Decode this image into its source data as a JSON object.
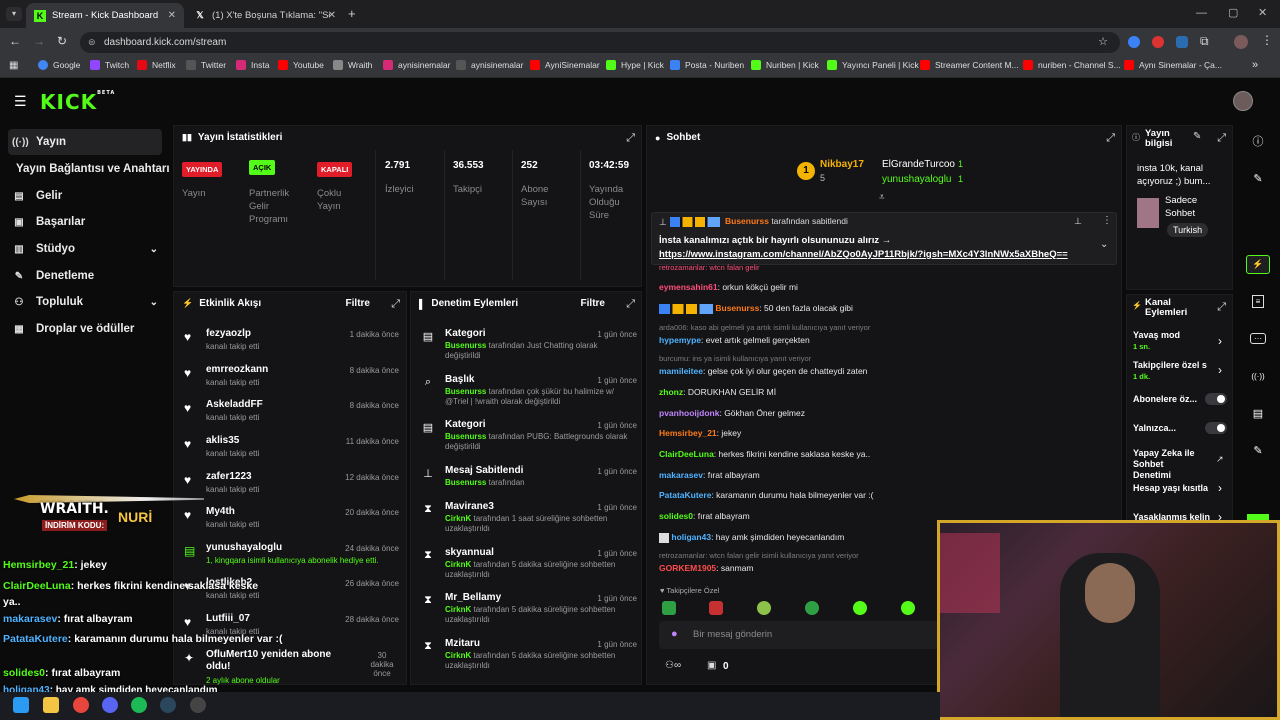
{
  "browser": {
    "tabs": [
      {
        "label": "Stream - Kick Dashboard",
        "active": true
      },
      {
        "label": "(1) X'te Boşuna Tıklama: \"Soru:",
        "active": false
      }
    ],
    "url": "dashboard.kick.com/stream",
    "bookmarks": [
      "Google",
      "Twitch",
      "Netflix",
      "Twitter",
      "Insta",
      "Youtube",
      "Wraith",
      "aynisinemalar",
      "aynisinemalar",
      "AyniSinemalar",
      "Hype | Kick",
      "Posta - Nuriben",
      "Nuriben | Kick",
      "Yayıncı Paneli | Kick",
      "Streamer Content M...",
      "nuriben - Channel S...",
      "Aynı Sinemalar - Ça..."
    ]
  },
  "kick": {
    "logo": "KICK",
    "beta": "BETA"
  },
  "sidebar": {
    "items": [
      {
        "label": "Yayın",
        "icon": "broadcast-icon"
      },
      {
        "label": "Yayın Bağlantısı ve Anahtarı",
        "icon": ""
      },
      {
        "label": "Gelir",
        "icon": "revenue-icon"
      },
      {
        "label": "Başarılar",
        "icon": "trophy-icon"
      },
      {
        "label": "Stüdyo",
        "icon": "studio-icon"
      },
      {
        "label": "Denetleme",
        "icon": "wrench-icon"
      },
      {
        "label": "Topluluk",
        "icon": "users-icon"
      },
      {
        "label": "Droplar ve ödüller",
        "icon": "gift-icon"
      }
    ]
  },
  "stats": {
    "title": "Yayın İstatistikleri",
    "badges": [
      {
        "text": "YAYINDA",
        "color": "#e11d2a",
        "label": "Yayın"
      },
      {
        "text": "AÇIK",
        "color": "#53fc18",
        "label": "Partnerlik Gelir Programı"
      },
      {
        "text": "KAPALI",
        "color": "#e11d2a",
        "label": "Çoklu Yayın"
      }
    ],
    "values": [
      {
        "value": "2.791",
        "label": "İzleyici"
      },
      {
        "value": "36.553",
        "label": "Takipçi"
      },
      {
        "value": "252",
        "label": "Abone Sayısı"
      },
      {
        "value": "03:42:59",
        "label": "Yayında Olduğu Süre"
      }
    ]
  },
  "events": {
    "title": "Etkinlik Akışı",
    "filter": "Filtre",
    "items": [
      {
        "name": "fezyaozlp",
        "sub": "kanalı takip etti",
        "time": "1 dakika önce"
      },
      {
        "name": "emrreozkann",
        "sub": "kanalı takip etti",
        "time": "8 dakika önce"
      },
      {
        "name": "AskeladdFF",
        "sub": "kanalı takip etti",
        "time": "8 dakika önce"
      },
      {
        "name": "aklis35",
        "sub": "kanalı takip etti",
        "time": "11 dakika önce"
      },
      {
        "name": "zafer1223",
        "sub": "kanalı takip etti",
        "time": "12 dakika önce"
      },
      {
        "name": "My4th",
        "sub": "kanalı takip etti",
        "time": "20 dakika önce"
      },
      {
        "name": "yunushayaloglu",
        "sub": "1, kingqara isimli kullanıcıya abonelik hediye etti.",
        "time": "24 dakika önce"
      },
      {
        "name": "lostlikeb2",
        "sub": "kanalı takip etti",
        "time": "26 dakika önce"
      },
      {
        "name": "Lutfiii_07",
        "sub": "kanalı takip etti",
        "time": "28 dakika önce"
      },
      {
        "name": "OfluMert10 yeniden abone oldu!",
        "sub": "2 aylık abone oldular",
        "time": "30 dakika önce"
      }
    ]
  },
  "mod": {
    "title": "Denetim Eylemleri",
    "filter": "Filtre",
    "items": [
      {
        "title": "Kategori",
        "time": "1 gün önce",
        "actor": "Busenurss",
        "desc": "tarafından Just Chatting olarak değiştirildi",
        "icon": "category-icon"
      },
      {
        "title": "Başlık",
        "time": "1 gün önce",
        "actor": "Busenurss",
        "desc": "tarafından çok şükür bu halimize w/ @Triel | !wraith olarak değiştirildi",
        "icon": "title-icon"
      },
      {
        "title": "Kategori",
        "time": "1 gün önce",
        "actor": "Busenurss",
        "desc": "tarafından PUBG: Battlegrounds olarak değiştirildi",
        "icon": "category-icon"
      },
      {
        "title": "Mesaj Sabitlendi",
        "time": "1 gün önce",
        "actor": "Busenurss",
        "desc": "tarafından",
        "icon": "pin-icon"
      },
      {
        "title": "Mavirane3",
        "time": "1 gün önce",
        "actor": "CirknK",
        "desc": "tarafından 1 saat süreliğine sohbetten uzaklaştırıldı",
        "icon": "hourglass-icon"
      },
      {
        "title": "skyannual",
        "time": "1 gün önce",
        "actor": "CirknK",
        "desc": "tarafından 5 dakika süreliğine sohbetten uzaklaştırıldı",
        "icon": "hourglass-icon"
      },
      {
        "title": "Mr_Bellamy",
        "time": "1 gün önce",
        "actor": "CirknK",
        "desc": "tarafından 5 dakika süreliğine sohbetten uzaklaştırıldı",
        "icon": "hourglass-icon"
      },
      {
        "title": "Mzitaru",
        "time": "1 gün önce",
        "actor": "CirknK",
        "desc": "tarafından 5 dakika süreliğine sohbetten uzaklaştırıldı",
        "icon": "hourglass-icon"
      }
    ]
  },
  "chat": {
    "title": "Sohbet",
    "top": [
      {
        "name": "Nikbay17",
        "count": "5",
        "rank": "1"
      },
      {
        "name": "ElGrandeTurcoo",
        "count": "1"
      },
      {
        "name": "yunushayaloglu",
        "count": "1"
      }
    ],
    "pinned": {
      "by": "Busenurss",
      "by_suffix": "tarafından sabitlendi",
      "text": "İnsta kanalımızı açtık bir hayırlı olsununuzu alırız →",
      "link": "https://www.instagram.com/channel/AbZQo0AyJP11Rbjk/?igsh=MXc4Y3lnNWx5aXBheQ=="
    },
    "messages": [
      {
        "type": "reply",
        "text": "retrozamanlar: wtcn falan gelir"
      },
      {
        "user": "eymensahin61",
        "color": "#ff4d7a",
        "text": "orkun kökçü gelir mi"
      },
      {
        "user": "Busenurss",
        "color": "#ff7a1a",
        "text": "50 den fazla olacak gibi"
      },
      {
        "type": "reply",
        "text": "arda006: kaso abi gelmeli ya artık isimli kullanıcıya yanıt veriyor"
      },
      {
        "user": "hypemype",
        "color": "#4fb3ff",
        "text": "evet artık gelmeli gerçekten"
      },
      {
        "type": "reply",
        "text": "burcumu: ins ya isimli kullanıcıya yanıt veriyor"
      },
      {
        "user": "mamileitee",
        "color": "#4fb3ff",
        "text": "gelse çok iyi olur geçen de chatteydi zaten"
      },
      {
        "user": "zhonz",
        "color": "#53fc18",
        "text": "DORUKHAN GELİR Mİ"
      },
      {
        "user": "pvanhooijdonk",
        "color": "#c084fc",
        "text": "Gökhan Öner gelmez"
      },
      {
        "user": "Hemsirbey_21",
        "color": "#ff7a1a",
        "text": "jekey"
      },
      {
        "user": "ClairDeeLuna",
        "color": "#53fc18",
        "text": "herkes fikrini kendine saklasa keske ya.."
      },
      {
        "user": "makarasev",
        "color": "#4fb3ff",
        "text": "fırat albayram"
      },
      {
        "user": "PatataKutere",
        "color": "#4fb3ff",
        "text": "karamanın durumu hala bilmeyenler var :("
      },
      {
        "user": "solides0",
        "color": "#53fc18",
        "text": "fırat albayram"
      },
      {
        "user": "holigan43",
        "color": "#4fb3ff",
        "text": "hay amk şimdiden heyecanlandım"
      },
      {
        "type": "reply",
        "text": "retrozamanlar: wtcn falan gelir isimli kullanıcıya yanıt veriyor"
      },
      {
        "user": "GORKEM1905",
        "color": "#ff4d4d",
        "text": "sanmam"
      }
    ],
    "followers_only": "Takipçilere Özel",
    "placeholder": "Bir mesaj gönderin",
    "count": "0"
  },
  "info": {
    "title": "Yayın bilgisi",
    "desc": "insta 10k, kanal açıyoruz ;) bum...",
    "category": "Sadece Sohbet",
    "language": "Turkish"
  },
  "actions": {
    "title": "Kanal Eylemleri",
    "items": [
      {
        "label": "Yavaş mod",
        "sub": "1 sn.",
        "control": "chevron"
      },
      {
        "label": "Takipçilere özel s",
        "sub": "1 dk.",
        "control": "chevron"
      },
      {
        "label": "Abonelere öz...",
        "sub": "",
        "control": "toggle"
      },
      {
        "label": "Yalnızca...",
        "sub": "",
        "control": "toggle"
      },
      {
        "label": "Yapay Zeka ile Sohbet Denetimi",
        "sub": "",
        "control": "external"
      },
      {
        "label": "Hesap yaşı kısıtla",
        "sub": "",
        "control": "chevron"
      },
      {
        "label": "Yasaklanmış kelin",
        "sub": "",
        "control": "chevron"
      }
    ]
  },
  "overlay": {
    "promo_brand": "WRAITH.",
    "promo_label": "İNDİRİM KODU:",
    "promo_code": "NURİ",
    "chat": [
      {
        "user": "Hemsirbey_21",
        "text": ": jekey"
      },
      {
        "user": "ClairDeeLuna",
        "text": ": herkes fikrini kendine saklasa keske ya.."
      },
      {
        "user": "makarasev",
        "text": ": fırat albayram"
      },
      {
        "user": "PatataKutere",
        "text": ": karamanın durumu hala bilmeyenler var :("
      },
      {
        "user": "solides0",
        "text": ": fırat albayram"
      },
      {
        "user": "holigan43",
        "text": ": hay amk şimdiden heyecanlandım"
      }
    ]
  }
}
